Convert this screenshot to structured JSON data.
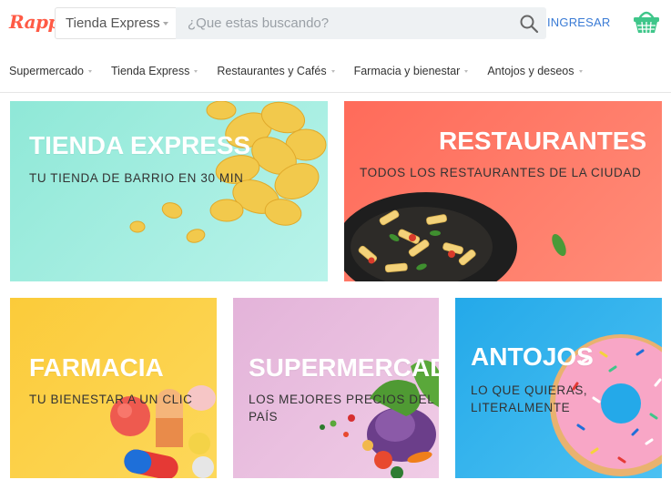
{
  "header": {
    "logo": "Rappi",
    "store_selector": "Tienda Express",
    "search_placeholder": "¿Que estas buscando?",
    "login_label": "INGRESAR",
    "brand_color": "#ff5a45",
    "link_color": "#3a7bd5",
    "basket_color": "#3fc68a"
  },
  "nav": {
    "items": [
      {
        "label": "Supermercado"
      },
      {
        "label": "Tienda Express"
      },
      {
        "label": "Restaurantes y Cafés"
      },
      {
        "label": "Farmacia y bienestar"
      },
      {
        "label": "Antojos y deseos"
      }
    ]
  },
  "cards": {
    "tienda": {
      "title": "TIENDA EXPRESS",
      "subtitle": "TU TIENDA DE BARRIO EN 30 MIN",
      "color": "#8fe8d7"
    },
    "restaurantes": {
      "title": "RESTAURANTES",
      "subtitle": "TODOS LOS RESTAURANTES DE LA CIUDAD",
      "color": "#ff6b5a"
    },
    "farmacia": {
      "title": "FARMACIA",
      "subtitle": "TU BIENESTAR A UN CLIC",
      "color": "#fbcb3a"
    },
    "supermercado": {
      "title": "SUPERMERCADO",
      "subtitle": "LOS MEJORES PRECIOS DEL PAÍS",
      "color": "#e3b3d9"
    },
    "antojos": {
      "title": "ANTOJOS",
      "subtitle": "LO QUE QUIERAS, LITERALMENTE",
      "color": "#24a9e9"
    }
  }
}
